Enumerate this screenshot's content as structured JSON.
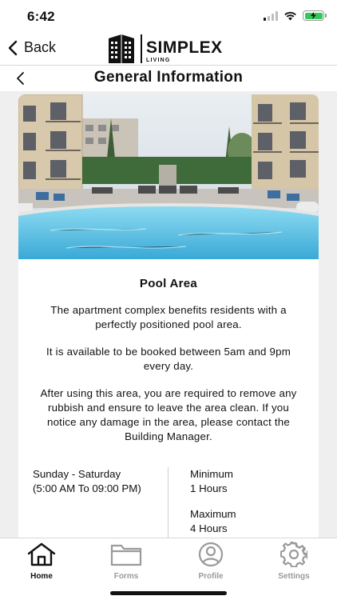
{
  "status": {
    "time": "6:42"
  },
  "nav": {
    "back_label": "Back",
    "brand_name": "SIMPLEX",
    "brand_sub": "LIVING"
  },
  "page": {
    "title": "General Information"
  },
  "card": {
    "title": "Pool Area",
    "paragraphs": [
      "The apartment complex benefits residents with a perfectly positioned pool area.",
      "It is available to be booked between 5am and 9pm every day.",
      "After using this area, you are required to remove any rubbish and ensure to leave the area clean. If you notice any damage in the area, please contact the Building Manager."
    ],
    "schedule_days": "Sunday - Saturday",
    "schedule_hours": "(5:00 AM To 09:00 PM)",
    "minimum_label": "Minimum",
    "minimum_value": "1 Hours",
    "maximum_label": "Maximum",
    "maximum_value": "4 Hours"
  },
  "tabs": [
    {
      "label": "Home",
      "icon": "home-icon",
      "active": true
    },
    {
      "label": "Forms",
      "icon": "folder-icon",
      "active": false
    },
    {
      "label": "Profile",
      "icon": "profile-icon",
      "active": false
    },
    {
      "label": "Settings",
      "icon": "gear-icon",
      "active": false
    }
  ],
  "colors": {
    "battery": "#34c759",
    "pool": "#5cc6e8",
    "sky": "#dfe8ef",
    "hedge": "#3f6a3a"
  }
}
